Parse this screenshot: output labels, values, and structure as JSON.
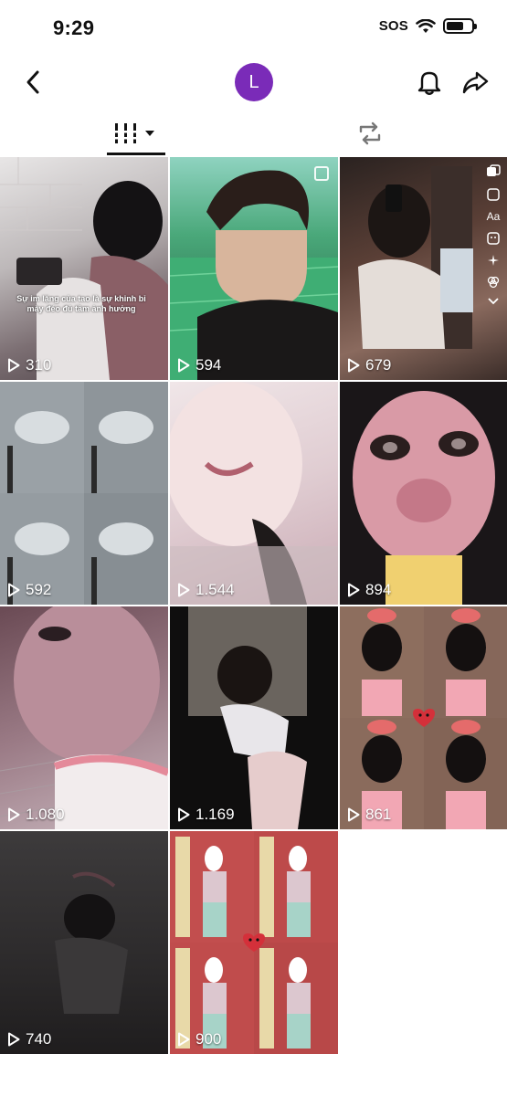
{
  "status_bar": {
    "time": "9:29",
    "sos": "SOS",
    "battery_level": 0.6
  },
  "header": {
    "avatar_initial": "L"
  },
  "icons": {
    "back": "chevron-left-icon",
    "bell": "bell-icon",
    "share": "share-arrow-icon",
    "videos_tab": "grid-icon",
    "reposts_tab": "repost-icon"
  },
  "grid": {
    "tiles": [
      {
        "views": "310",
        "caption": "Sự im lặng của tao là sự khinh bỉ mày đéo đủ tầm ảnh hưởng"
      },
      {
        "views": "594"
      },
      {
        "views": "679"
      },
      {
        "views": "592"
      },
      {
        "views": "1.544"
      },
      {
        "views": "894"
      },
      {
        "views": "1.080"
      },
      {
        "views": "1.169"
      },
      {
        "views": "861"
      },
      {
        "views": "740"
      },
      {
        "views": "900"
      }
    ]
  },
  "tile3_tools": {
    "text_tool": "Aa"
  },
  "colors": {
    "accent_avatar": "#7a2bb8"
  }
}
